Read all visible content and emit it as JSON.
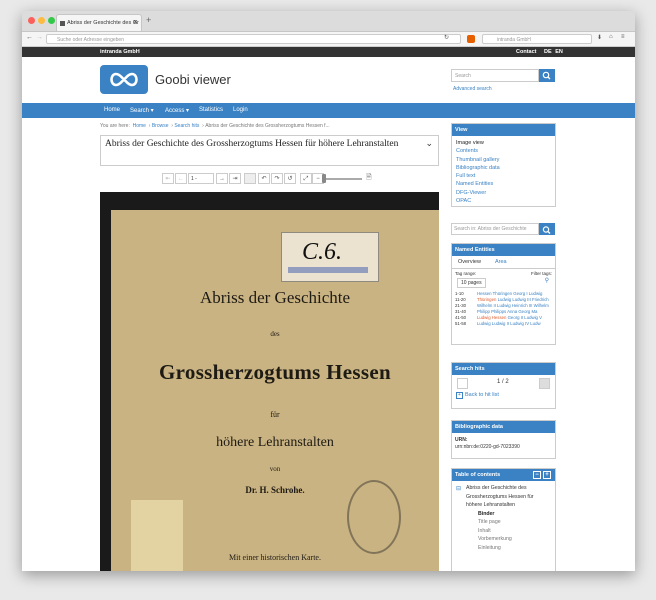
{
  "browser": {
    "tab_title": "Abriss der Geschichte des Gr",
    "url_placeholder": "Suche oder Adresse eingeben",
    "search_placeholder": "intranda GmbH"
  },
  "top": {
    "brand": "intranda GmbH",
    "contact": "Contact",
    "lang_de": "DE",
    "lang_en": "EN"
  },
  "header": {
    "app_name": "Goobi viewer",
    "search_placeholder": "Search",
    "advanced": "Advanced search"
  },
  "nav": {
    "home": "Home",
    "search": "Search ▾",
    "access": "Access ▾",
    "statistics": "Statistics",
    "login": "Login"
  },
  "breadcrumb": {
    "prefix": "You are here:",
    "items": [
      "Home",
      "Browse",
      "Search hits"
    ],
    "current": "Abriss der Geschichte des Grossherzogtums Hessen f..."
  },
  "title": "Abriss der Geschichte des Grossherzogtums Hessen für höhere Lehranstalten",
  "toolbar": {
    "page_select": "1 -"
  },
  "cover": {
    "line1": "Abriss der Geschichte",
    "line2": "des",
    "line3": "Grossherzogtums Hessen",
    "line4": "für",
    "line5": "höhere Lehranstalten",
    "line6": "von",
    "line7": "Dr. H. Schrohe.",
    "line8": "Mit einer historischen Karte.",
    "label": "C.6."
  },
  "view_panel": {
    "title": "View",
    "items": [
      "Image view",
      "Contents",
      "Thumbnail gallery",
      "Bibliographic data",
      "Full text",
      "Named Entities",
      "DFG-Viewer",
      "OPAC"
    ]
  },
  "search_in": {
    "placeholder": "Search in: Abriss der Geschichte"
  },
  "named_entities": {
    "title": "Named Entities",
    "tab_overview": "Overview",
    "tab_area": "Area",
    "tag_range": "Tag range:",
    "filter_tags": "Filter tags:",
    "range_select": "10 pages",
    "rows": [
      {
        "range": "1-10",
        "a": "Hessen Thüringen",
        "b": "Georg I Ludwig"
      },
      {
        "range": "11-20",
        "a": "Thüringen",
        "b": "Ludwig Ludwig III Friedrich"
      },
      {
        "range": "21-30",
        "a": "Wilhelm II Ludwig",
        "b": "Heinrich III Wilhelm"
      },
      {
        "range": "31-40",
        "a": "Philipp Philipps",
        "b": "Anna Georg Ma"
      },
      {
        "range": "41-50",
        "a": "Ludwig Hessen",
        "b": "Georg II Ludwig V"
      },
      {
        "range": "51-58",
        "a": "Ludwig Ludwig",
        "b": "II Ludwig IV Ludw"
      }
    ]
  },
  "search_hits": {
    "title": "Search hits",
    "counter": "1 / 2",
    "back": "Back to hit list"
  },
  "biblio": {
    "title": "Bibliographic data",
    "urn_label": "URN:",
    "urn_value": "urn:nbn:de:0220-gd-7023390"
  },
  "toc": {
    "title": "Table of contents",
    "root": "Abriss der Geschichte des Grossherzogtums Hessen für höhere Lehranstalten",
    "current": "Binder",
    "items": [
      "Title page",
      "Inhalt",
      "Vorbemerkung",
      "Einleitung"
    ]
  },
  "colors": {
    "accent": "#3a82c4",
    "topstrip": "#333333"
  }
}
